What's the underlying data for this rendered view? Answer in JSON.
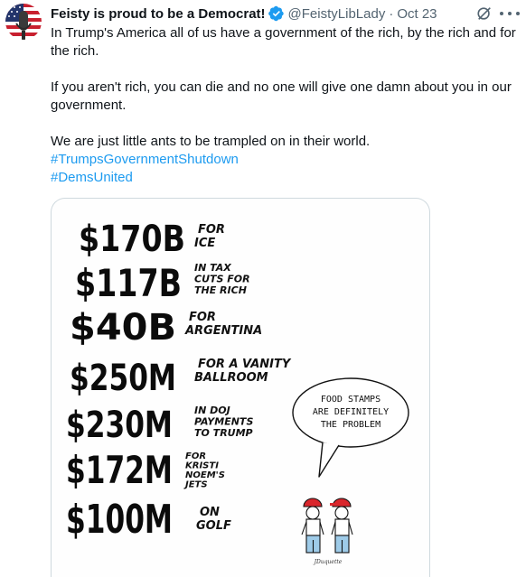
{
  "author": {
    "display_name": "Feisty is proud to be a Democrat!",
    "handle": "@FeistyLibLady",
    "separator": "·",
    "date": "Oct 23",
    "verified_icon": "verified-badge-icon",
    "avatar_icon": "flag-avatar-icon"
  },
  "actions": {
    "grok_icon": "grok-icon",
    "more_icon": "more-options-icon"
  },
  "body": {
    "line1": "In Trump's America all of us have a government of the rich, by the rich and for the rich.",
    "line2": "If you aren't rich, you can die and no one will give one damn about you in our government.",
    "line3": "We are just little ants to be trampled on in their world.",
    "hashtag1": "#TrumpsGovernmentShutdown",
    "hashtag2": "#DemsUnited"
  },
  "cartoon": {
    "items": [
      {
        "amount": "$170B",
        "caption": [
          "FOR",
          "ICE"
        ]
      },
      {
        "amount": "$117B",
        "caption": [
          "IN TAX",
          "CUTS FOR",
          "THE RICH"
        ]
      },
      {
        "amount": "$40B",
        "caption": [
          "FOR",
          "ARGENTINA"
        ]
      },
      {
        "amount": "$250M",
        "caption": [
          "FOR A VANITY",
          "BALLROOM"
        ]
      },
      {
        "amount": "$230M",
        "caption": [
          "IN DOJ",
          "PAYMENTS",
          "TO TRUMP"
        ]
      },
      {
        "amount": "$172M",
        "caption": [
          "FOR",
          "KRISTI",
          "NOEM'S",
          "JETS"
        ]
      },
      {
        "amount": "$100M",
        "caption": [
          "ON",
          "GOLF"
        ]
      }
    ],
    "speech_bubble": [
      "FOOD STAMPS",
      "ARE DEFINITELY",
      "THE PROBLEM"
    ],
    "signature": "JDuquette",
    "colors": {
      "ink": "#0b0b0b",
      "hat": "#d9262c",
      "pants": "#9ecbe8"
    }
  },
  "colors": {
    "link": "#1d9bf0",
    "verified": "#1d9bf0",
    "muted": "#536471"
  }
}
